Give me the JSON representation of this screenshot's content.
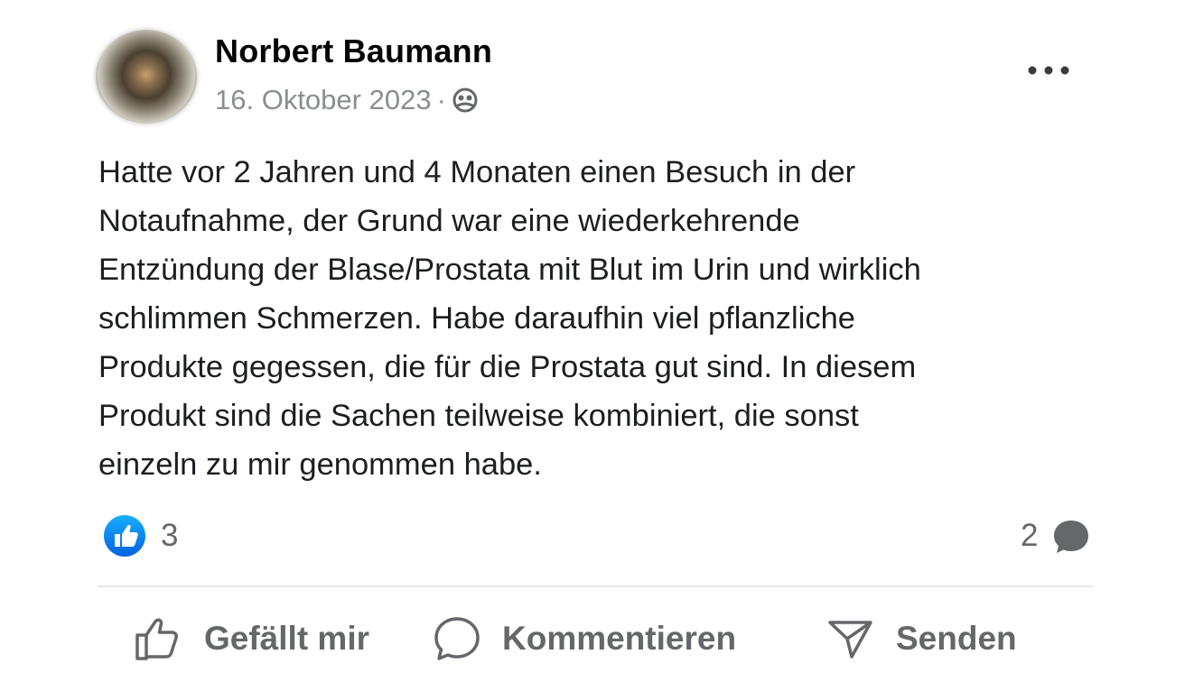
{
  "post": {
    "author": "Norbert Baumann",
    "date": "16. Oktober 2023",
    "separator": "·",
    "audience_icon": "friends-icon",
    "body": "Hatte vor 2 Jahren und 4 Monaten einen Besuch in der\nNotaufnahme, der Grund war eine wiederkehrende\nEntzündung der Blase/Prostata mit Blut im Urin und wirklich\nschlimmen Schmerzen. Habe daraufhin viel pflanzliche\nProdukte gegessen, die für die Prostata gut sind. In diesem\nProdukt sind die Sachen teilweise kombiniert, die sonst\neinzeln zu mir genommen habe."
  },
  "reactions": {
    "like_count": "3",
    "comment_count": "2"
  },
  "actions": {
    "like_label": "Gefällt mir",
    "comment_label": "Kommentieren",
    "send_label": "Senden"
  },
  "colors": {
    "like_blue": "#1877f2",
    "secondary_text": "#65676b",
    "meta_text": "#8a8d91",
    "divider": "#e4e6eb"
  }
}
